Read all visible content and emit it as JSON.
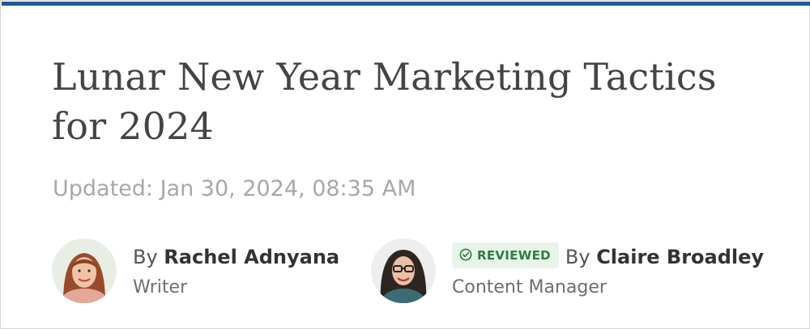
{
  "article": {
    "title": "Lunar New Year Marketing Tactics for 2024",
    "updated": "Updated: Jan 30, 2024, 08:35 AM"
  },
  "authors": [
    {
      "by": "By ",
      "name": "Rachel Adnyana",
      "role": "Writer"
    },
    {
      "badge": "REVIEWED",
      "by": "By ",
      "name": "Claire Broadley",
      "role": "Content Manager"
    }
  ],
  "colors": {
    "accent_bar": "#1f5a96",
    "title": "#444444",
    "muted": "#a8a8a8",
    "badge_bg": "#e6f4ea",
    "badge_fg": "#2e7d3e"
  },
  "icons": {
    "reviewed": "check-circle-icon"
  }
}
